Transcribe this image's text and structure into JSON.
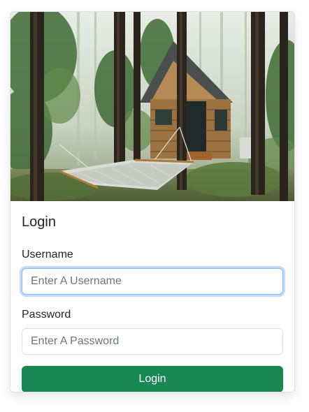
{
  "card": {
    "image_alt": "Cabin in the woods with a hammock",
    "title": "Login",
    "username": {
      "label": "Username",
      "placeholder": "Enter A Username",
      "value": ""
    },
    "password": {
      "label": "Password",
      "placeholder": "Enter A Password",
      "value": ""
    },
    "submit_label": "Login"
  },
  "colors": {
    "primary_button": "#198754",
    "focus_ring": "#86b7fe"
  }
}
